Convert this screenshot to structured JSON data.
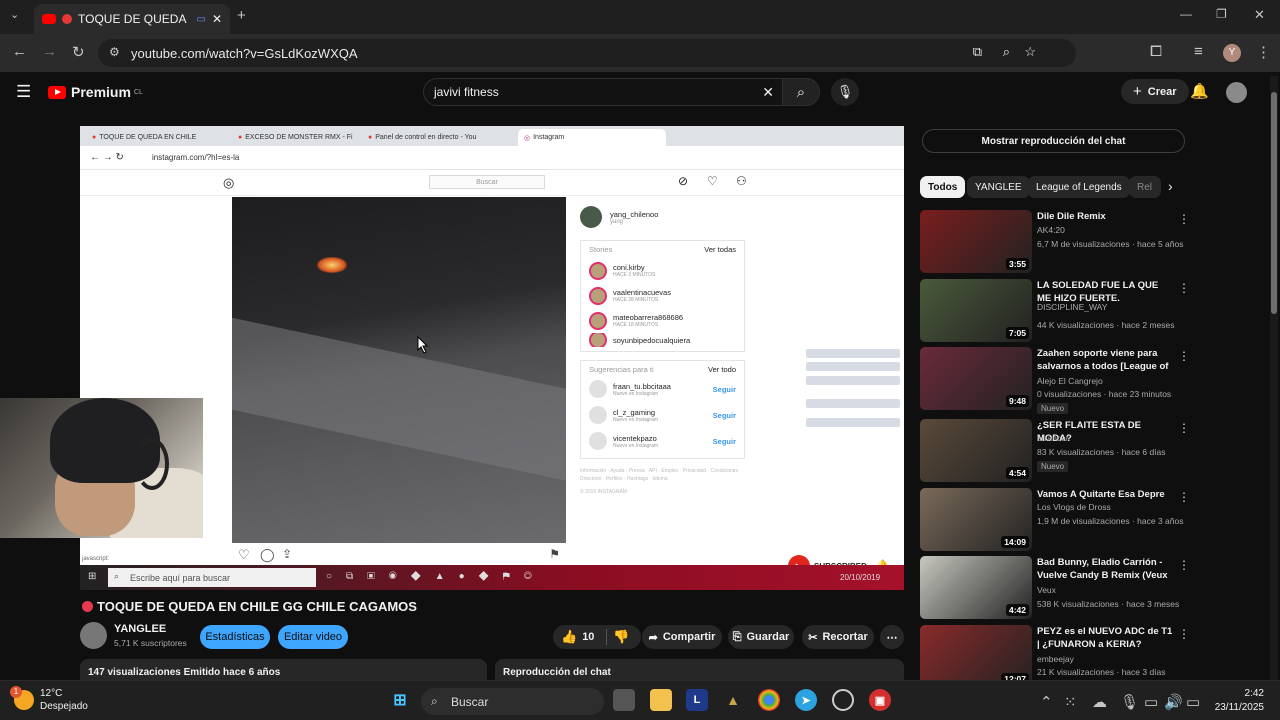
{
  "browser": {
    "tab_title": "TOQUE DE QUEDA EN C",
    "url": "youtube.com/watch?v=GsLdKozWXQA",
    "profile_initial": "Y"
  },
  "youtube": {
    "logo_text": "Premium",
    "logo_region": "CL",
    "search_value": "javivi fitness",
    "create_label": "Crear"
  },
  "video": {
    "inner_tabs": [
      "TOQUE DE QUEDA EN CHILE",
      "EXCESO DE MONSTER RMX - Fi",
      "Panel de control en directo - You",
      "Instagram"
    ],
    "inner_url": "instagram.com/?hl=es-la",
    "ig_search_placeholder": "Buscar",
    "ig_username": "yang_chilenoo",
    "ig_user_sub": "yang",
    "stories_label": "Stories",
    "stories_see_all": "Ver todas",
    "stories": [
      {
        "name": "coni.kirby",
        "time": "HACE 3 MINUTOS"
      },
      {
        "name": "vaalentinacuevas",
        "time": "HACE 28 MINUTOS"
      },
      {
        "name": "mateobarrera868686",
        "time": "HACE 18 MINUTOS"
      },
      {
        "name": "soyunbipedocualquiera",
        "time": ""
      }
    ],
    "suggestions_label": "Sugerencias para ti",
    "suggestions_see_all": "Ver todo",
    "suggestions": [
      {
        "name": "fraan_tu.bbcitaaa",
        "sub": "Nuevo en Instagram",
        "action": "Seguir"
      },
      {
        "name": "cl_z_gaming",
        "sub": "Nuevo en Instagram",
        "action": "Seguir"
      },
      {
        "name": "vicentekpazo",
        "sub": "Nuevo en Instagram",
        "action": "Seguir"
      }
    ],
    "ig_footer": "Información · Ayuda · Prensa · API · Empleo · Privacidad · Condiciones · Directorio · Perfiles · Hashtags · Idioma",
    "ig_copyright": "© 2019 INSTAGRAM",
    "inner_taskbar_search": "Escribe aquí para buscar",
    "subscribed_label": "SUBSCRIBED",
    "inner_clock_date": "20/10/2019",
    "inner_status": "javascript:"
  },
  "info": {
    "title": "TOQUE DE QUEDA EN CHILE GG CHILE CAGAMOS",
    "channel_name": "YANGLEE",
    "subscribers": "5,71 K suscriptores",
    "stats_label": "Estadísticas",
    "edit_label": "Editar video",
    "likes": "10",
    "share_label": "Compartir",
    "save_label": "Guardar",
    "clip_label": "Recortar",
    "views_line": "147 visualizaciones  Emitido hace 6 años",
    "chat_replay_label": "Reproducción del chat"
  },
  "sidebar": {
    "show_chat_label": "Mostrar reproducción del chat",
    "chips": [
      "Todos",
      "YANGLEE",
      "League of Legends",
      "Rel"
    ],
    "items": [
      {
        "title": "Dile Dile Remix",
        "channel": "AK4:20",
        "meta": "6,7 M de visualizaciones · hace 5 años",
        "duration": "3:55",
        "badge": "",
        "thumb_color": "#7a1d1d"
      },
      {
        "title": "LA SOLEDAD FUE LA QUE ME HIZO FUERTE.",
        "channel": "DISCIPLINE_WAY",
        "meta": "44 K visualizaciones · hace 2 meses",
        "duration": "7:05",
        "badge": "",
        "thumb_color": "#4a5a3a"
      },
      {
        "title": "Zaahen soporte viene para salvarnos a todos [League of ...",
        "channel": "Alejo El Cangrejo",
        "meta": "0 visualizaciones · hace 23 minutos",
        "duration": "9:48",
        "badge": "Nuevo",
        "thumb_color": "#6a2a3a"
      },
      {
        "title": "¿SER FLAITE ESTA DE MODA?",
        "channel": "arrancar",
        "meta": "83 K visualizaciones · hace 6 días",
        "duration": "4:54",
        "badge": "Nuevo",
        "thumb_color": "#5a4a3a"
      },
      {
        "title": "Vamos A Quitarte Esa Depre",
        "channel": "Los Vlogs de Dross",
        "meta": "1,9 M de visualizaciones · hace 3 años",
        "duration": "14:09",
        "badge": "",
        "thumb_color": "#7a6a5a"
      },
      {
        "title": "Bad Bunny, Eladio Carrión - Vuelve Candy B Remix (Veux ...",
        "channel": "Veux",
        "meta": "538 K visualizaciones · hace 3 meses",
        "duration": "4:42",
        "badge": "",
        "thumb_color": "#c8c8c0"
      },
      {
        "title": "PEYZ es el NUEVO ADC de T1 | ¿FUNARON a KERIA?",
        "channel": "embeejay",
        "meta": "21 K visualizaciones · hace 3 días",
        "duration": "12:07",
        "badge": "",
        "thumb_color": "#8a2a2a"
      }
    ]
  },
  "taskbar": {
    "temperature": "12°C",
    "weather": "Despejado",
    "weather_badge": "1",
    "search_label": "Buscar",
    "time": "2:42",
    "date": "23/11/2025"
  }
}
